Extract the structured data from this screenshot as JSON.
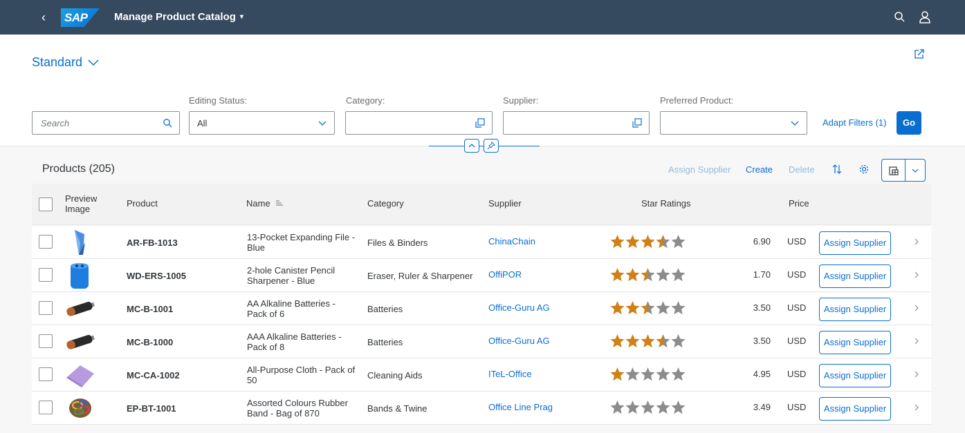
{
  "shell": {
    "back_glyph": "‹",
    "logo_text": "SAP",
    "title": "Manage Product Catalog",
    "title_caret": "▾",
    "search_icon": "search-icon",
    "user_icon": "user-icon"
  },
  "header": {
    "variant_name": "Standard",
    "share_icon": "share-icon"
  },
  "filters": {
    "search_placeholder": "Search",
    "editing_status_label": "Editing Status:",
    "editing_status_value": "All",
    "category_label": "Category:",
    "category_value": "",
    "supplier_label": "Supplier:",
    "supplier_value": "",
    "preferred_label": "Preferred Product:",
    "preferred_value": "",
    "adapt_filters": "Adapt Filters (1)",
    "go": "Go"
  },
  "toolbar": {
    "title": "Products (205)",
    "assign_supplier": "Assign Supplier",
    "create": "Create",
    "delete": "Delete"
  },
  "columns": {
    "preview_image": "Preview Image",
    "product": "Product",
    "name": "Name",
    "category": "Category",
    "supplier": "Supplier",
    "star_ratings": "Star Ratings",
    "price": "Price"
  },
  "rows": [
    {
      "product": "AR-FB-1013",
      "name": "13-Pocket Expanding File - Blue",
      "category": "Files & Binders",
      "supplier": "ChinaChain",
      "rating": 3.5,
      "price": "6.90",
      "currency": "USD",
      "action": "Assign Supplier",
      "image": "blue-file-folder"
    },
    {
      "product": "WD-ERS-1005",
      "name": "2-hole Canister Pencil Sharpener - Blue",
      "category": "Eraser, Ruler & Sharpener",
      "supplier": "OffiPOR",
      "rating": 2.5,
      "price": "1.70",
      "currency": "USD",
      "action": "Assign Supplier",
      "image": "blue-sharpener"
    },
    {
      "product": "MC-B-1001",
      "name": "AA Alkaline Batteries - Pack of 6",
      "category": "Batteries",
      "supplier": "Office-Guru AG",
      "rating": 2.5,
      "price": "3.50",
      "currency": "USD",
      "action": "Assign Supplier",
      "image": "battery"
    },
    {
      "product": "MC-B-1000",
      "name": "AAA Alkaline Batteries - Pack of 8",
      "category": "Batteries",
      "supplier": "Office-Guru AG",
      "rating": 3.5,
      "price": "3.50",
      "currency": "USD",
      "action": "Assign Supplier",
      "image": "battery"
    },
    {
      "product": "MC-CA-1002",
      "name": "All-Purpose Cloth - Pack of 50",
      "category": "Cleaning Aids",
      "supplier": "ITeL-Office",
      "rating": 1,
      "price": "4.95",
      "currency": "USD",
      "action": "Assign Supplier",
      "image": "purple-cloth"
    },
    {
      "product": "EP-BT-1001",
      "name": "Assorted Colours Rubber Band - Bag of 870",
      "category": "Bands & Twine",
      "supplier": "Office Line Prag",
      "rating": 0,
      "price": "3.49",
      "currency": "USD",
      "action": "Assign Supplier",
      "image": "rubber-bands"
    }
  ],
  "colors": {
    "shell": "#354a5f",
    "accent": "#0a6ed1",
    "star_filled": "#d08014",
    "star_empty": "#8c8c8c"
  }
}
